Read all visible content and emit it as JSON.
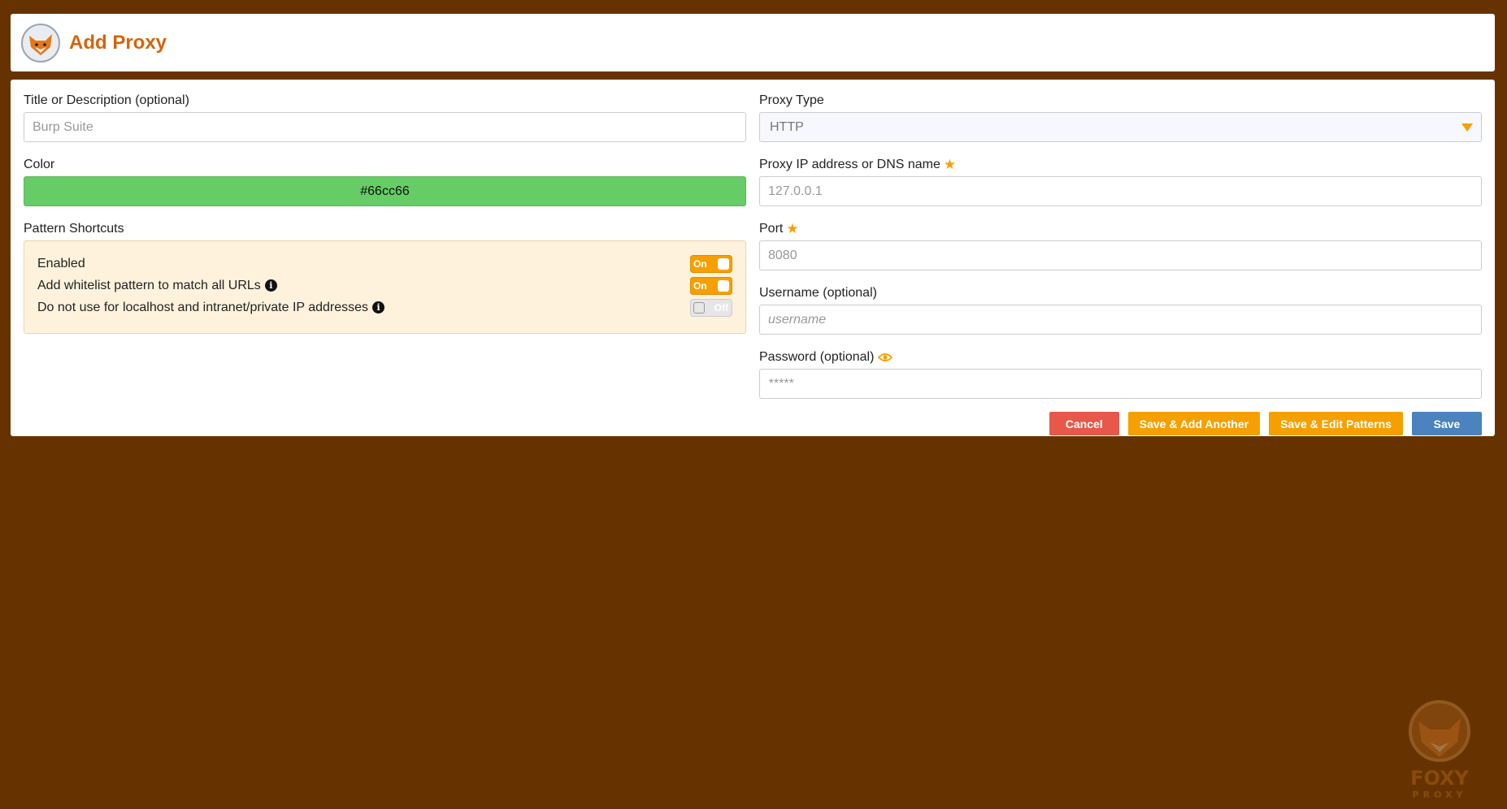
{
  "header": {
    "title": "Add Proxy"
  },
  "left": {
    "title_label": "Title or Description (optional)",
    "title_placeholder": "Burp Suite",
    "color_label": "Color",
    "color_value": "#66cc66",
    "shortcuts_label": "Pattern Shortcuts",
    "shortcuts": [
      {
        "label": "Enabled",
        "toggle": "On"
      },
      {
        "label": "Add whitelist pattern to match all URLs",
        "toggle": "On"
      },
      {
        "label": "Do not use for localhost and intranet/private IP addresses",
        "toggle": "Off"
      }
    ]
  },
  "right": {
    "type_label": "Proxy Type",
    "type_value": "HTTP",
    "ip_label": "Proxy IP address or DNS name",
    "ip_placeholder": "127.0.0.1",
    "port_label": "Port",
    "port_placeholder": "8080",
    "username_label": "Username (optional)",
    "username_placeholder": "username",
    "password_label": "Password (optional)",
    "password_placeholder": "*****"
  },
  "buttons": {
    "cancel": "Cancel",
    "save_add": "Save & Add Another",
    "save_edit": "Save & Edit Patterns",
    "save": "Save"
  },
  "watermark": {
    "line1": "FOXY",
    "line2": "PROXY"
  },
  "colors": {
    "accent": "#f5a000",
    "background": "#663300",
    "cancel": "#e8584a",
    "save": "#4a83bd"
  }
}
